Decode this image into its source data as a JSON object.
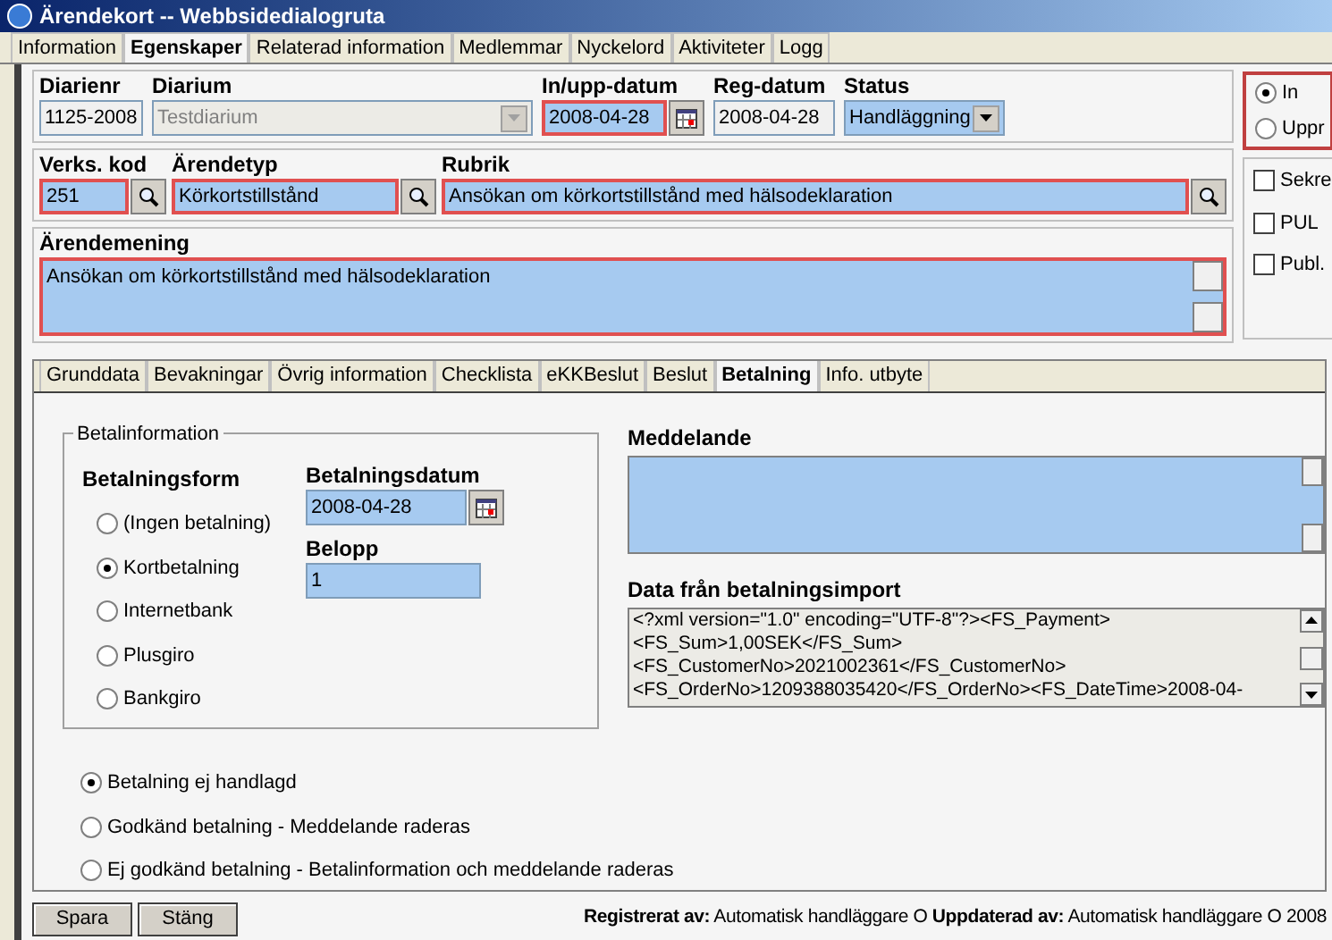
{
  "window": {
    "title": "Ärendekort -- Webbsidedialogruta"
  },
  "tabs": [
    {
      "label": "Information",
      "selected": false
    },
    {
      "label": "Egenskaper",
      "selected": true
    },
    {
      "label": "Relaterad information",
      "selected": false
    },
    {
      "label": "Medlemmar",
      "selected": false
    },
    {
      "label": "Nyckelord",
      "selected": false
    },
    {
      "label": "Aktiviteter",
      "selected": false
    },
    {
      "label": "Logg",
      "selected": false
    }
  ],
  "header": {
    "diarienr": {
      "label": "Diarienr",
      "value": "1125-2008",
      "required": false
    },
    "diarium": {
      "label": "Diarium",
      "value": "Testdiarium",
      "disabled": true
    },
    "in_upp_datum": {
      "label": "In/upp-datum",
      "value": "2008-04-28",
      "required": true
    },
    "reg_datum": {
      "label": "Reg-datum",
      "value": "2008-04-28",
      "required": false
    },
    "status": {
      "label": "Status",
      "value": "Handläggning"
    }
  },
  "direction": [
    {
      "label": "In",
      "selected": true
    },
    {
      "label": "Uppr",
      "selected": false
    }
  ],
  "flags": [
    {
      "label": "Sekre",
      "checked": false
    },
    {
      "label": "PUL",
      "checked": false
    },
    {
      "label": "Publ.",
      "checked": false
    }
  ],
  "verks_kod": {
    "label": "Verks. kod",
    "value": "251",
    "required": true
  },
  "arendetyp": {
    "label": "Ärendetyp",
    "value": "Körkortstillstånd",
    "required": true
  },
  "rubrik": {
    "label": "Rubrik",
    "value": "Ansökan om körkortstillstånd med hälsodeklaration",
    "required": true
  },
  "arendemening": {
    "label": "Ärendemening",
    "value": "Ansökan om körkortstillstånd med hälsodeklaration",
    "required": true
  },
  "subtabs": [
    {
      "label": "Grunddata",
      "selected": false
    },
    {
      "label": "Bevakningar",
      "selected": false
    },
    {
      "label": "Övrig information",
      "selected": false
    },
    {
      "label": "Checklista",
      "selected": false
    },
    {
      "label": "eKKBeslut",
      "selected": false
    },
    {
      "label": "Beslut",
      "selected": false
    },
    {
      "label": "Betalning",
      "selected": true
    },
    {
      "label": "Info. utbyte",
      "selected": false
    }
  ],
  "betalinformation": {
    "legend": "Betalinformation",
    "form_label": "Betalningsform",
    "options": [
      {
        "label": "(Ingen betalning)",
        "selected": false
      },
      {
        "label": "Kortbetalning",
        "selected": true
      },
      {
        "label": "Internetbank",
        "selected": false
      },
      {
        "label": "Plusgiro",
        "selected": false
      },
      {
        "label": "Bankgiro",
        "selected": false
      }
    ],
    "date": {
      "label": "Betalningsdatum",
      "value": "2008-04-28"
    },
    "amount": {
      "label": "Belopp",
      "value": "1"
    }
  },
  "meddelande": {
    "label": "Meddelande"
  },
  "import": {
    "label": "Data från betalningsimport",
    "value": "<?xml version=\"1.0\" encoding=\"UTF-8\"?><FS_Payment> <FS_Sum>1,00SEK</FS_Sum><FS_CustomerNo>2021002361</FS_CustomerNo><FS_OrderNo>1209388035420</FS_OrderNo><FS_DateTime>2008-04-"
  },
  "handling": [
    {
      "label": "Betalning ej handlagd",
      "selected": true
    },
    {
      "label": "Godkänd betalning - Meddelande raderas",
      "selected": false
    },
    {
      "label": "Ej godkänd betalning - Betalinformation och meddelande raderas",
      "selected": false
    }
  ],
  "buttons": [
    "Spara",
    "Stäng"
  ],
  "status_bar": "**Registrerat av:** Automatisk handläggare O **Uppdaterad av:** Automatisk handläggare O 2008"
}
